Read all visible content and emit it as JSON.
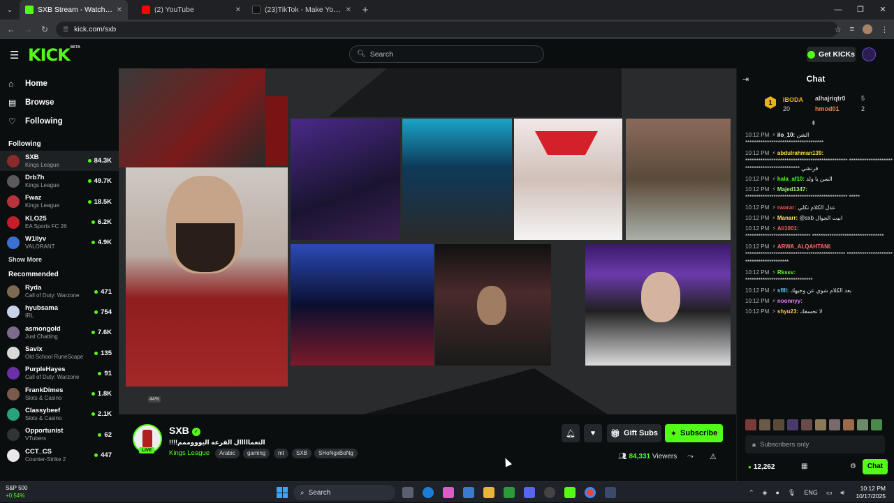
{
  "browser": {
    "tabs": [
      {
        "label": "SXB Stream - Watch Live on",
        "active": true,
        "favicon_color": "#53fc18"
      },
      {
        "label": "(2) YouTube",
        "active": false,
        "favicon_color": "#ff0000"
      },
      {
        "label": "(23)TikTok - Make Your Day",
        "active": false,
        "favicon_color": "#222222"
      }
    ],
    "url": "kick.com/sxb"
  },
  "header": {
    "logo": "KICK",
    "logo_badge": "BETA",
    "search_placeholder": "Search",
    "get_kicks": "Get KICKs"
  },
  "sidebar": {
    "nav": [
      {
        "label": "Home",
        "icon": "home-icon"
      },
      {
        "label": "Browse",
        "icon": "browse-icon"
      },
      {
        "label": "Following",
        "icon": "heart-icon"
      }
    ],
    "following_title": "Following",
    "following": [
      {
        "name": "SXB",
        "category": "Kings League",
        "viewers": "84.3K",
        "color": "#8a2b2b"
      },
      {
        "name": "Drb7h",
        "category": "Kings League",
        "viewers": "49.7K",
        "color": "#5a5a5a"
      },
      {
        "name": "Fwaz",
        "category": "Kings League",
        "viewers": "18.5K",
        "color": "#b8323b"
      },
      {
        "name": "KLO25",
        "category": "EA Sports FC 26",
        "viewers": "6.2K",
        "color": "#c41e2a"
      },
      {
        "name": "W1llyv",
        "category": "VALORANT",
        "viewers": "4.9K",
        "color": "#3b6fd1"
      }
    ],
    "show_more": "Show More",
    "recommended_title": "Recommended",
    "recommended": [
      {
        "name": "Ryda",
        "category": "Call of Duty: Warzone",
        "viewers": "471",
        "color": "#7c6b52"
      },
      {
        "name": "hyubsama",
        "category": "IRL",
        "viewers": "754",
        "color": "#c9d4e8"
      },
      {
        "name": "asmongold",
        "category": "Just Chatting",
        "viewers": "7.6K",
        "color": "#7b6b8c"
      },
      {
        "name": "Savix",
        "category": "Old School RuneScape",
        "viewers": "135",
        "color": "#d9d9d9"
      },
      {
        "name": "PurpleHayes",
        "category": "Call of Duty: Warzone",
        "viewers": "91",
        "color": "#6b2fa8"
      },
      {
        "name": "FrankDimes",
        "category": "Slots & Casino",
        "viewers": "1.8K",
        "color": "#7a5a4a"
      },
      {
        "name": "Classybeef",
        "category": "Slots & Casino",
        "viewers": "2.1K",
        "color": "#2aa37a"
      },
      {
        "name": "Opportunist",
        "category": "VTubers",
        "viewers": "62",
        "color": "#333333"
      },
      {
        "name": "CCT_CS",
        "category": "Counter-Strike 2",
        "viewers": "447",
        "color": "#e8e8e8"
      }
    ]
  },
  "video": {
    "badge": "44%"
  },
  "stream": {
    "name": "SXB",
    "live": "LIVE",
    "title": "!!!!التعمااااال القرعه اليوووممم",
    "category": "Kings League",
    "tags": [
      "Arabic",
      "gaming",
      "mt",
      "SXB",
      "SHoNgxBoNg"
    ],
    "gift_subs": "Gift Subs",
    "subscribe": "Subscribe",
    "viewers": "84,331",
    "viewers_label": "Viewers"
  },
  "chat": {
    "title": "Chat",
    "leaderboard": {
      "first": {
        "name": "IBODA",
        "count": "20"
      },
      "second": {
        "name": "alhajriqtr0",
        "count": "5"
      },
      "third": {
        "name": "hmod01",
        "count": "2"
      }
    },
    "messages": [
      {
        "time": "10:12 PM",
        "user": "ilo_10:",
        "color": "#ffffff",
        "text": "الشن",
        "body": "************************************"
      },
      {
        "time": "10:12 PM",
        "user": "abdulrahman139:",
        "color": "#f5d84a",
        "text": "",
        "body": "*********************************************** ********************************************* قرنشي"
      },
      {
        "time": "10:12 PM",
        "user": "hala_af10:",
        "color": "#53fc18",
        "text": "السن يا ولد",
        "body": ""
      },
      {
        "time": "10:12 PM",
        "user": "Majed1347:",
        "color": "#a5f27a",
        "text": "",
        "body": "*********************************************** *****"
      },
      {
        "time": "10:12 PM",
        "user": "rwarar:",
        "color": "#ff4b4b",
        "text": "عدل الكلام نكلي",
        "body": ""
      },
      {
        "time": "10:12 PM",
        "user": "Manarr:",
        "color": "#ffe36a",
        "text": "@sxb ابيت الجوال",
        "body": ""
      },
      {
        "time": "10:12 PM",
        "user": "Ali1001:",
        "color": "#ff5d5d",
        "text": "",
        "body": "****************************** *********************************"
      },
      {
        "time": "10:12 PM",
        "user": "ARWA_ALQAHTANI:",
        "color": "#ff6b6b",
        "text": "",
        "body": "********************************************** *****************************************"
      },
      {
        "time": "10:12 PM",
        "user": "Rkssv:",
        "color": "#53fc18",
        "text": "",
        "body": "*******************************"
      },
      {
        "time": "10:12 PM",
        "user": "sflll:",
        "color": "#5ac8ff",
        "text": "بعد الكلام شوي عن وجيهك",
        "body": ""
      },
      {
        "time": "10:12 PM",
        "user": "noonnyy:",
        "color": "#e67cff",
        "text": "",
        "body": ""
      },
      {
        "time": "10:12 PM",
        "user": "shyu23:",
        "color": "#f5c84a",
        "text": "لا تحسفك",
        "body": ""
      }
    ],
    "input_placeholder": "Subscribers only",
    "kicks": "12,262",
    "send": "Chat"
  },
  "taskbar": {
    "stock_name": "S&P 500",
    "stock_change": "+0.54%",
    "search": "Search",
    "lang": "ENG",
    "time": "10:12 PM",
    "date": "10/17/2025"
  }
}
